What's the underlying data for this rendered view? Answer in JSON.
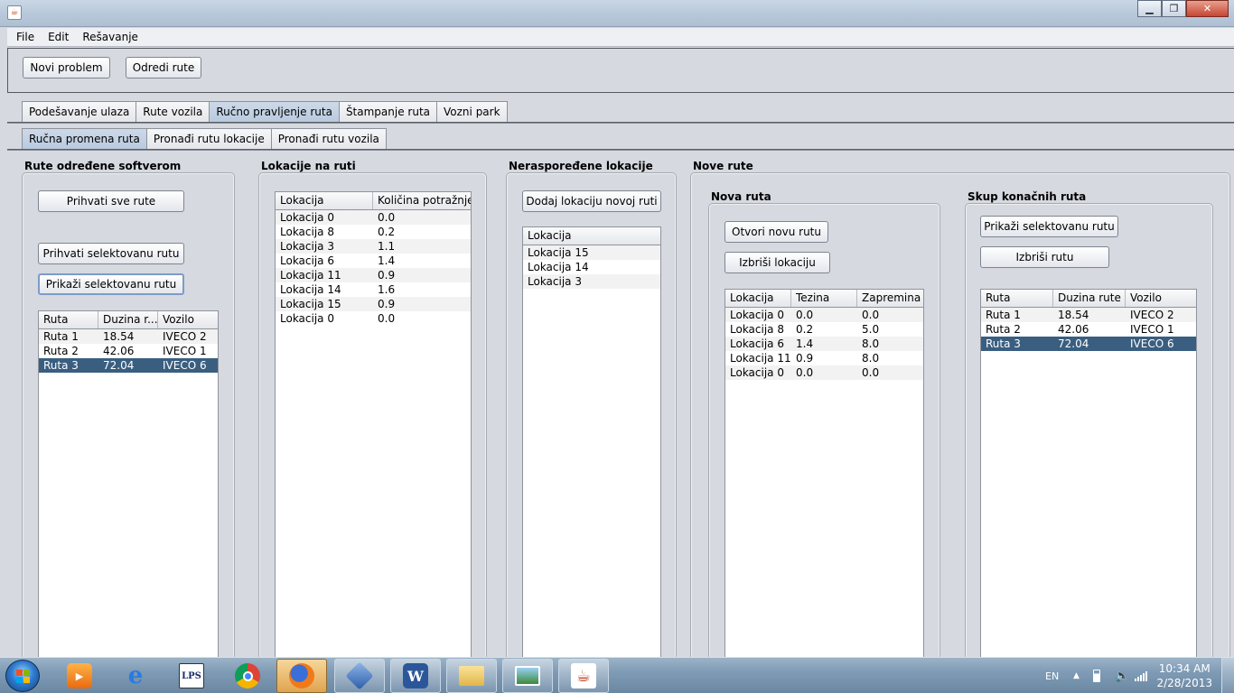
{
  "menu": [
    "File",
    "Edit",
    "Rešavanje"
  ],
  "toolbar": {
    "new_problem": "Novi problem",
    "solve_routes": "Odredi rute"
  },
  "main_tabs": [
    "Podešavanje ulaza",
    "Rute vozila",
    "Ručno pravljenje ruta",
    "Štampanje ruta",
    "Vozni park"
  ],
  "sub_tabs": [
    "Ručna promena ruta",
    "Pronađi rutu lokacije",
    "Pronađi rutu vozila"
  ],
  "software_routes": {
    "title": "Rute određene softverom",
    "accept_all": "Prihvati sve rute",
    "accept_selected": "Prihvati selektovanu rutu",
    "show_selected": "Prikaži selektovanu rutu",
    "columns": [
      "Ruta",
      "Duzina r...",
      "Vozilo"
    ],
    "rows": [
      [
        "Ruta 1",
        "18.54",
        "IVECO 2"
      ],
      [
        "Ruta 2",
        "42.06",
        "IVECO 1"
      ],
      [
        "Ruta 3",
        "72.04",
        "IVECO 6"
      ]
    ]
  },
  "route_locations": {
    "title": "Lokacije na ruti",
    "columns": [
      "Lokacija",
      "Količina potražnje"
    ],
    "rows": [
      [
        "Lokacija 0",
        "0.0"
      ],
      [
        "Lokacija 8",
        "0.2"
      ],
      [
        "Lokacija 3",
        "1.1"
      ],
      [
        "Lokacija 6",
        "1.4"
      ],
      [
        "Lokacija 11",
        "0.9"
      ],
      [
        "Lokacija 14",
        "1.6"
      ],
      [
        "Lokacija 15",
        "0.9"
      ],
      [
        "Lokacija 0",
        "0.0"
      ]
    ]
  },
  "unassigned": {
    "title": "Neraspoređene lokacije",
    "add_button": "Dodaj lokaciju novoj ruti",
    "columns": [
      "Lokacija"
    ],
    "rows": [
      [
        "Lokacija 15"
      ],
      [
        "Lokacija 14"
      ],
      [
        "Lokacija 3"
      ]
    ]
  },
  "new_routes": {
    "title": "Nove rute",
    "new_route": {
      "title": "Nova ruta",
      "open_button": "Otvori novu rutu",
      "delete_button": "Izbriši lokaciju",
      "columns": [
        "Lokacija",
        "Tezina",
        "Zapremina"
      ],
      "rows": [
        [
          "Lokacija 0",
          "0.0",
          "0.0"
        ],
        [
          "Lokacija 8",
          "0.2",
          "5.0"
        ],
        [
          "Lokacija 6",
          "1.4",
          "8.0"
        ],
        [
          "Lokacija 11",
          "0.9",
          "8.0"
        ],
        [
          "Lokacija 0",
          "0.0",
          "0.0"
        ]
      ]
    },
    "final_set": {
      "title": "Skup konačnih ruta",
      "show_button": "Prikaži selektovanu rutu",
      "delete_button": "Izbriši rutu",
      "columns": [
        "Ruta",
        "Duzina rute",
        "Vozilo"
      ],
      "rows": [
        [
          "Ruta 1",
          "18.54",
          "IVECO 2"
        ],
        [
          "Ruta 2",
          "42.06",
          "IVECO 1"
        ],
        [
          "Ruta 3",
          "72.04",
          "IVECO 6"
        ]
      ]
    }
  },
  "taskbar": {
    "lang": "EN",
    "time": "10:34 AM",
    "date": "2/28/2013",
    "apps": [
      "media-player",
      "internet-explorer",
      "lps",
      "chrome",
      "firefox",
      "virtualbox",
      "word",
      "file-explorer",
      "photo-viewer",
      "java"
    ],
    "lps_label": "LPS"
  }
}
